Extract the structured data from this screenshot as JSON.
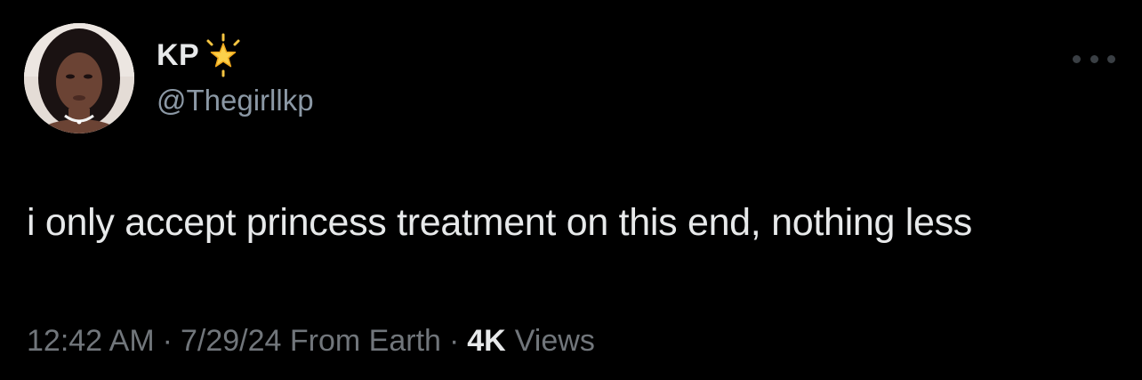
{
  "tweet": {
    "author": {
      "display_name": "KP",
      "handle": "@Thegirllkp",
      "badge_icon": "glowing-star-icon",
      "badge_color": "#f5c542"
    },
    "more_icon": "more-horizontal-icon",
    "text": "i only accept princess treatment on this end, nothing less",
    "meta": {
      "time": "12:42 AM",
      "separator": "·",
      "date": "7/29/24",
      "source": "From Earth",
      "views_count": "4K",
      "views_label": "Views"
    }
  },
  "colors": {
    "background": "#000000",
    "primary_text": "#e7e9ea",
    "secondary_text": "#71767b"
  }
}
